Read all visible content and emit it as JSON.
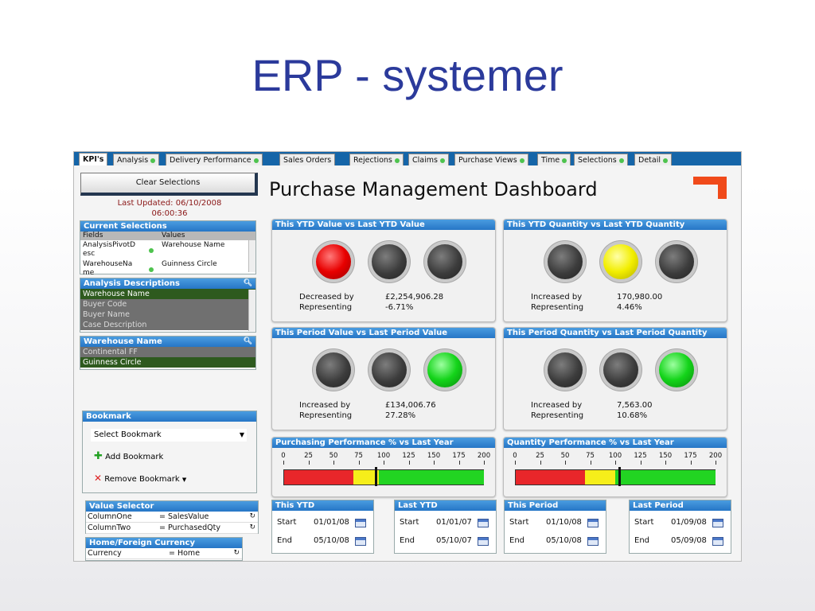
{
  "slide": {
    "title": "ERP - systemer"
  },
  "tabs": [
    "KPI's",
    "Analysis",
    "Delivery Performance",
    "Sales Orders",
    "Rejections",
    "Claims",
    "Purchase Views",
    "Time",
    "Selections",
    "Detail"
  ],
  "left": {
    "clear_label": "Clear Selections",
    "last_updated": "Last Updated: 06/10/2008",
    "last_updated_time": "06:00:36",
    "current_selections": {
      "title": "Current Selections",
      "col_fields": "Fields",
      "col_values": "Values",
      "rows": [
        {
          "field1": "AnalysisPivotD",
          "field2": "esc",
          "value": "Warehouse Name"
        },
        {
          "field1": "WarehouseNa",
          "field2": "me",
          "value": "Guinness Circle"
        }
      ]
    },
    "analysis_descriptions": {
      "title": "Analysis Descriptions",
      "items": [
        "Warehouse Name",
        "Buyer Code",
        "Buyer Name",
        "Case Description"
      ]
    },
    "warehouse_name": {
      "title": "Warehouse Name",
      "items": [
        "Continental FF",
        "Guinness Circle"
      ]
    },
    "bookmark": {
      "title": "Bookmark",
      "select_label": "Select Bookmark",
      "add_label": "Add Bookmark",
      "remove_label": "Remove Bookmark"
    },
    "value_selector": {
      "title": "Value Selector",
      "rows": [
        {
          "key": "ColumnOne",
          "value": "= SalesValue"
        },
        {
          "key": "ColumnTwo",
          "value": "= PurchasedQty"
        }
      ]
    },
    "currency": {
      "title": "Home/Foreign Currency",
      "key": "Currency",
      "value": "= Home"
    }
  },
  "dashboard": {
    "title": "Purchase Management Dashboard",
    "accent_color": "#f04a1a",
    "kpis": [
      {
        "title": "This YTD Value vs Last YTD Value",
        "lights": [
          "red",
          "off",
          "off"
        ],
        "label1": "Decreased by",
        "value1": "£2,254,906.28",
        "label2": "Representing",
        "value2": "-6.71%"
      },
      {
        "title": "This YTD Quantity vs Last YTD Quantity",
        "lights": [
          "off",
          "yellow",
          "off"
        ],
        "label1": "Increased by",
        "value1": "170,980.00",
        "label2": "Representing",
        "value2": "4.46%"
      },
      {
        "title": "This Period Value vs Last Period Value",
        "lights": [
          "off",
          "off",
          "green"
        ],
        "label1": "Increased by",
        "value1": "£134,006.76",
        "label2": "Representing",
        "value2": "27.28%"
      },
      {
        "title": "This Period Quantity vs Last Period Quantity",
        "lights": [
          "off",
          "off",
          "green"
        ],
        "label1": "Increased by",
        "value1": "7,563.00",
        "label2": "Representing",
        "value2": "10.68%"
      }
    ],
    "gauges": [
      {
        "title": "Purchasing Performance % vs Last Year",
        "scale": [
          "0",
          "25",
          "50",
          "75",
          "100",
          "125",
          "150",
          "175",
          "200"
        ],
        "value": 92,
        "bands": [
          {
            "to": 70,
            "color": "#e8262a"
          },
          {
            "to": 95,
            "color": "#f6ee1a"
          },
          {
            "to": 200,
            "color": "#22d422"
          }
        ]
      },
      {
        "title": "Quantity Performance % vs Last Year",
        "scale": [
          "0",
          "25",
          "50",
          "75",
          "100",
          "125",
          "150",
          "175",
          "200"
        ],
        "value": 104,
        "bands": [
          {
            "to": 70,
            "color": "#e8262a"
          },
          {
            "to": 100,
            "color": "#f6ee1a"
          },
          {
            "to": 200,
            "color": "#22d422"
          }
        ]
      }
    ],
    "dates": [
      {
        "title": "This YTD",
        "start_label": "Start",
        "start": "01/01/08",
        "end_label": "End",
        "end": "05/10/08"
      },
      {
        "title": "Last YTD",
        "start_label": "Start",
        "start": "01/01/07",
        "end_label": "End",
        "end": "05/10/07"
      },
      {
        "title": "This Period",
        "start_label": "Start",
        "start": "01/10/08",
        "end_label": "End",
        "end": "05/10/08"
      },
      {
        "title": "Last Period",
        "start_label": "Start",
        "start": "01/09/08",
        "end_label": "End",
        "end": "05/09/08"
      }
    ]
  }
}
